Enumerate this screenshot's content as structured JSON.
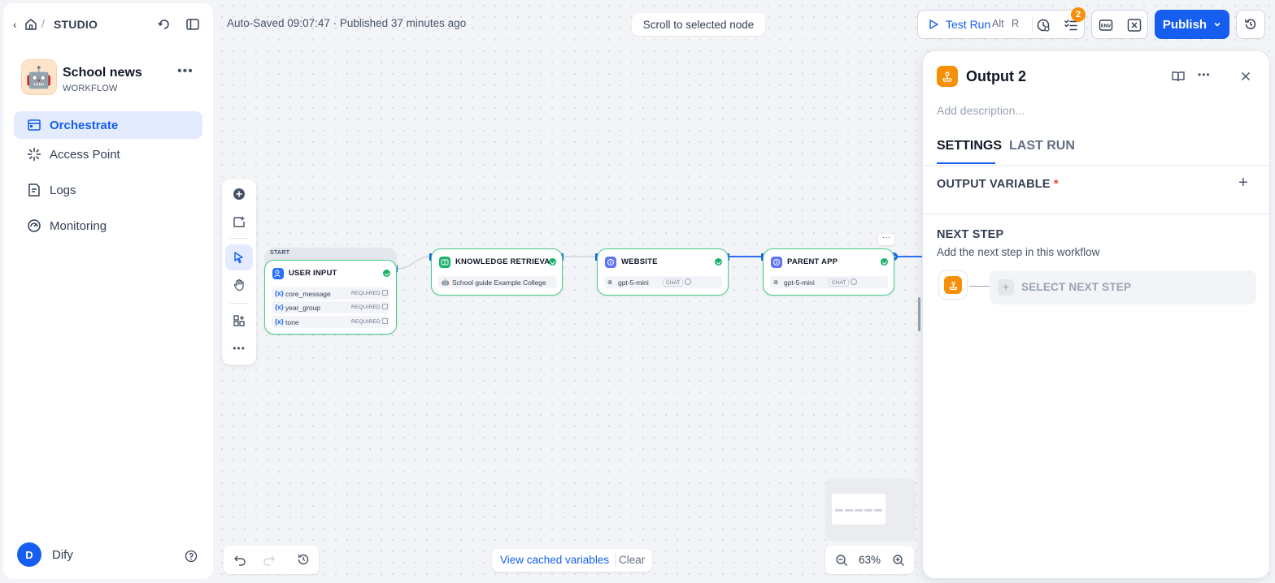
{
  "sidebar": {
    "breadcrumb": "STUDIO",
    "app": {
      "name": "School news",
      "type": "WORKFLOW",
      "avatar": "🤖"
    },
    "nav": [
      {
        "label": "Orchestrate",
        "icon": "orchestrate-icon",
        "active": true
      },
      {
        "label": "Access Point",
        "icon": "access-point-icon",
        "active": false
      },
      {
        "label": "Logs",
        "icon": "logs-icon",
        "active": false
      },
      {
        "label": "Monitoring",
        "icon": "monitoring-icon",
        "active": false
      }
    ],
    "user": {
      "initial": "D",
      "name": "Dify"
    }
  },
  "header": {
    "status": "Auto-Saved 09:07:47 · Published 37 minutes ago",
    "scroll_to_node": "Scroll to selected node",
    "test_run": {
      "label": "Test Run",
      "key1": "Alt",
      "key2": "R"
    },
    "pending_count": "2",
    "publish": "Publish"
  },
  "nodes": {
    "start_label": "START",
    "user_input": {
      "title": "USER INPUT",
      "vars": [
        {
          "name": "core_message",
          "req": "REQUIRED"
        },
        {
          "name": "year_group",
          "req": "REQUIRED"
        },
        {
          "name": "tone",
          "req": "REQUIRED"
        }
      ]
    },
    "knowledge": {
      "title": "KNOWLEDGE RETRIEVAL",
      "dataset": "School guide Example College"
    },
    "website": {
      "title": "WEBSITE",
      "model": "gpt-5-mini",
      "mode": "CHAT"
    },
    "parent_app": {
      "title": "PARENT APP",
      "model": "gpt-5-mini",
      "mode": "CHAT"
    }
  },
  "footer": {
    "view_cached": "View cached variables",
    "clear": "Clear",
    "zoom": "63%"
  },
  "panel": {
    "title": "Output 2",
    "description_placeholder": "Add description...",
    "tabs": [
      "SETTINGS",
      "LAST RUN"
    ],
    "output_variable": "OUTPUT VARIABLE",
    "required_mark": "*",
    "next_step_title": "NEXT STEP",
    "next_step_desc": "Add the next step in this workflow",
    "select_next": "SELECT NEXT STEP"
  },
  "colors": {
    "accent": "#155eef",
    "success": "#17b26a",
    "output": "#f79009"
  }
}
